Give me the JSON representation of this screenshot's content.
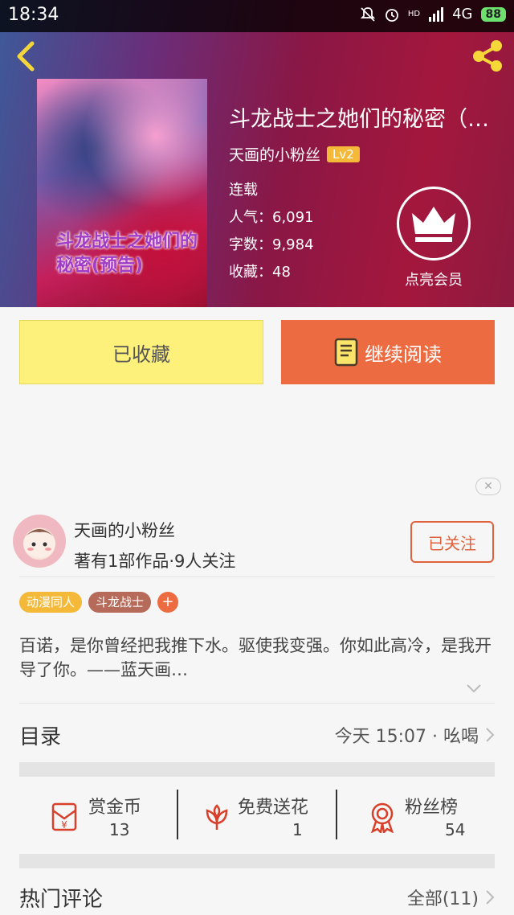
{
  "status_bar": {
    "time": "18:34",
    "network": "4G",
    "signal_hd": "HD",
    "battery": "88"
  },
  "icons": {
    "back": "back-arrow-icon",
    "share": "share-icon",
    "vip": "crown-icon",
    "book": "book-icon",
    "reward": "red-envelope-icon",
    "flower": "flower-icon",
    "fans": "medal-icon",
    "close": "close-icon",
    "chevron": "chevron-right-icon"
  },
  "book": {
    "title": "斗龙战士之她们的秘密（预告）",
    "cover_text": "斗龙战士之她们的秘密(预告)",
    "author": "天画的小粉丝",
    "level": "Lv2",
    "status": "连载",
    "popularity": "人气：6,091",
    "words": "字数：9,984",
    "favorites": "收藏：48"
  },
  "vip": {
    "label": "点亮会员"
  },
  "actions": {
    "favorited": "已收藏",
    "continue_read": "继续阅读"
  },
  "author_card": {
    "name": "天画的小粉丝",
    "sub": "著有1部作品·9人关注",
    "follow": "已关注"
  },
  "tags": [
    {
      "label": "动漫同人",
      "color": "#f5b93a"
    },
    {
      "label": "斗龙战士",
      "color": "#b56a5a"
    }
  ],
  "tag_add": "+",
  "intro": "百诺，是你曾经把我推下水。驱使我变强。你如此高冷，是我开导了你。——蓝天画…",
  "catalog": {
    "title": "目录",
    "latest": "今天 15:07 · 吆喝"
  },
  "stats": [
    {
      "label": "赏金币",
      "value": "13",
      "icon": "red-envelope-icon"
    },
    {
      "label": "免费送花",
      "value": "1",
      "icon": "flower-icon"
    },
    {
      "label": "粉丝榜",
      "value": "54",
      "icon": "medal-icon"
    }
  ],
  "comments": {
    "title": "热门评论",
    "all": "全部(11)"
  },
  "colors": {
    "accent": "#ec6b40",
    "favorite_btn": "#fdf17c",
    "icon_red": "#d8402a"
  }
}
